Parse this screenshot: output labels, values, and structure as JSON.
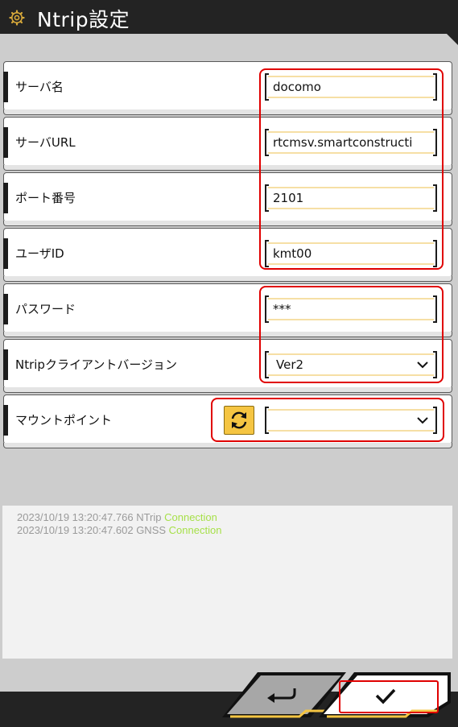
{
  "header": {
    "title": "Ntrip設定",
    "icon": "gear-icon"
  },
  "rows": [
    {
      "label": "サーバ名",
      "value": "docomo"
    },
    {
      "label": "サーバURL",
      "value": "rtcmsv.smartconstructi"
    },
    {
      "label": "ポート番号",
      "value": "2101"
    },
    {
      "label": "ユーザID",
      "value": "kmt00"
    },
    {
      "label": "パスワード",
      "value": "***"
    },
    {
      "label": "Ntripクライアントバージョン",
      "value": "Ver2"
    },
    {
      "label": "マウントポイント",
      "value": ""
    }
  ],
  "log": [
    {
      "text": "2023/10/19 13:20:47.766 NTrip ",
      "status": "Connection"
    },
    {
      "text": "2023/10/19 13:20:47.602 GNSS ",
      "status": "Connection"
    }
  ],
  "colors": {
    "accent": "#f5c542",
    "highlight": "#e00000",
    "status": "#a7e04a",
    "header": "#232323"
  }
}
